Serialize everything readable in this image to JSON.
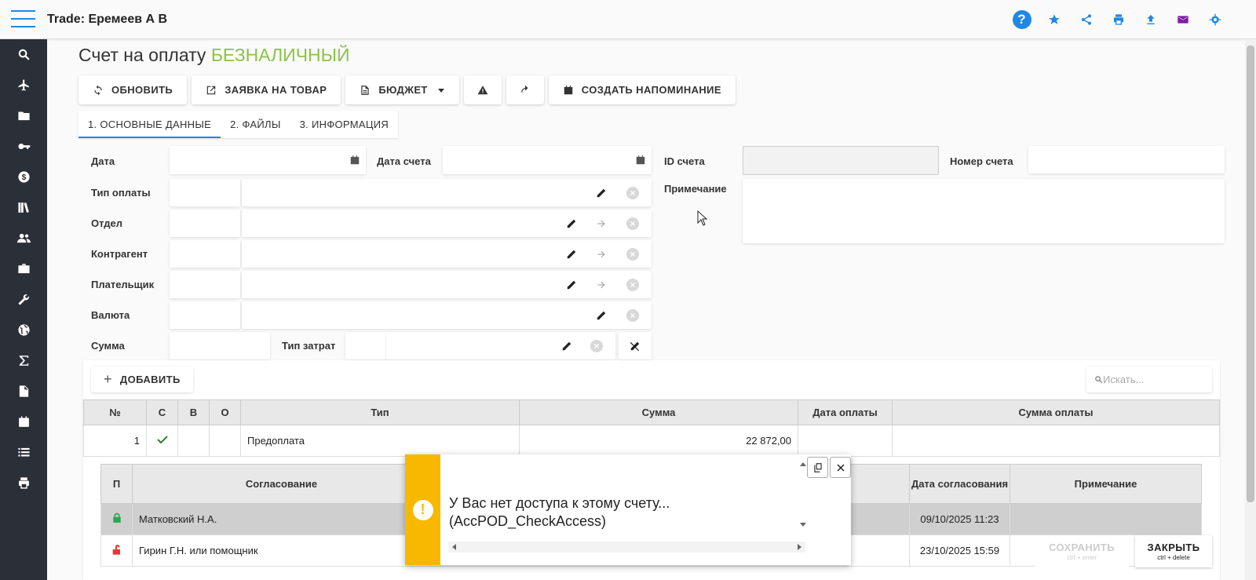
{
  "app": {
    "title": "Trade: Еремеев А В"
  },
  "colors": {
    "accent": "#1e88e5",
    "success": "#8bc34a",
    "warning": "#f9b800",
    "sidebar": "#2b2f36",
    "mail": "#7b1fa2"
  },
  "top_icons": [
    "help-icon",
    "star-icon",
    "share-icon",
    "print-icon",
    "upload-icon",
    "mail-icon",
    "settings-icon"
  ],
  "sidebar_icons": [
    "search-icon",
    "airplane-icon",
    "folder-icon",
    "key-icon",
    "dollar-icon",
    "library-icon",
    "people-icon",
    "briefcase-icon",
    "wrench-icon",
    "globe-icon",
    "sigma-icon",
    "document-icon",
    "calendar-icon",
    "list-icon",
    "print-icon"
  ],
  "page": {
    "title_main": "Счет на оплату",
    "title_accent": "БЕЗНАЛИЧНЫЙ"
  },
  "toolbar": {
    "refresh": "ОБНОВИТЬ",
    "request": "ЗАЯВКА НА ТОВАР",
    "budget": "БЮДЖЕТ",
    "reminder": "СОЗДАТЬ НАПОМИНАНИЕ"
  },
  "tabs": [
    "1. ОСНОВНЫЕ ДАННЫЕ",
    "2. ФАЙЛЫ",
    "3. ИНФОРМАЦИЯ"
  ],
  "form": {
    "date": "Дата",
    "invoice_date": "Дата счета",
    "invoice_id": "ID счета",
    "invoice_number": "Номер счета",
    "payment_type": "Тип оплаты",
    "note": "Примечание",
    "department": "Отдел",
    "counterparty": "Контрагент",
    "payer": "Плательщик",
    "currency": "Валюта",
    "amount": "Сумма",
    "cost_type": "Тип затрат"
  },
  "grid": {
    "add": "ДОБАВИТЬ",
    "search_placeholder": "Искать...",
    "columns": [
      "№",
      "С",
      "В",
      "О",
      "Тип",
      "Сумма",
      "Дата оплаты",
      "Сумма оплаты"
    ],
    "rows": [
      {
        "num": "1",
        "type": "Предоплата",
        "amount": "22 872,00"
      }
    ]
  },
  "approvals": {
    "columns": [
      "П",
      "Согласование",
      "Дата согласования",
      "Примечание"
    ],
    "rows": [
      {
        "name": "Матковский Н.А.",
        "date": "09/10/2025 11:23"
      },
      {
        "name": "Гирин Г.Н. или помощник",
        "date": "23/10/2025 15:59"
      }
    ]
  },
  "toast": {
    "message": "У Вас нет доступа к этому счету... (AccPOD_CheckAccess)"
  },
  "footer": {
    "save": "СОХРАНИТЬ",
    "save_hint": "ctrl + enter",
    "close": "ЗАКРЫТЬ",
    "close_hint": "ctrl + delete"
  }
}
